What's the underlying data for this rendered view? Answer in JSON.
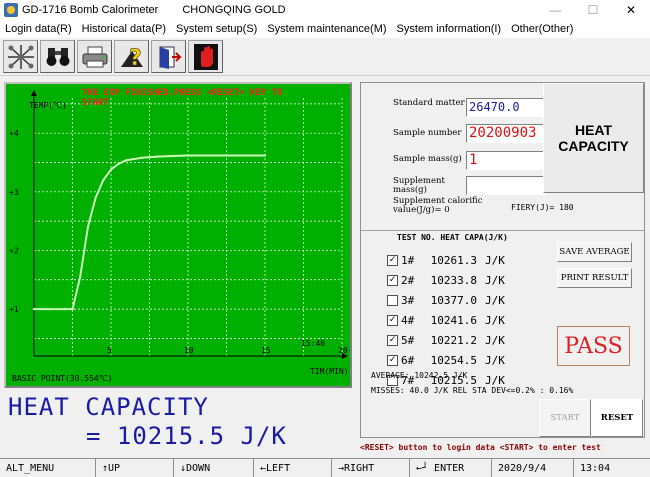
{
  "window": {
    "title": "GD-1716 Bomb Calorimeter",
    "company": "CHONGQING GOLD",
    "minimize": "—",
    "maximize": "☐",
    "close": "✕"
  },
  "menu": [
    "Login data(R)",
    "Historical data(P)",
    "System setup(S)",
    "System maintenance(M)",
    "System information(I)",
    "Other(Other)"
  ],
  "toolbar": {
    "icons": [
      "network-icon",
      "binoculars-icon",
      "printer-icon",
      "help-icon",
      "exit-door-icon",
      "stop-hand-icon"
    ]
  },
  "chart_data": {
    "type": "line",
    "banner": "THE EXP FINISHED,PRESS <RESET> KEY TO START",
    "ylabel": "TEMP(℃)",
    "xlabel": "TIM(MIN)",
    "x_ticks": [
      "5",
      "10",
      "15",
      "20"
    ],
    "y_ticks": [
      "+1",
      "+2",
      "+3",
      "+4"
    ],
    "xlim": [
      0,
      20
    ],
    "ylim": [
      0.2,
      4.6
    ],
    "time_readout": "15:40",
    "basic_point": "BASIC POINT(30.554℃)",
    "grid": true,
    "series": [
      {
        "x": [
          0,
          1,
          2,
          2.5,
          3,
          3.5,
          4,
          4.5,
          5,
          5.5,
          6,
          7,
          8,
          9,
          10,
          11,
          12,
          13,
          14,
          15
        ],
        "y": [
          1.0,
          1.0,
          1.0,
          1.0,
          1.55,
          2.4,
          2.9,
          3.2,
          3.38,
          3.48,
          3.54,
          3.58,
          3.6,
          3.61,
          3.62,
          3.62,
          3.62,
          3.62,
          3.62,
          3.62
        ]
      }
    ],
    "colors": {
      "background": "#00b000",
      "grid": "#ffffff",
      "line": "#c8ffb8",
      "banner": "#ff2020"
    }
  },
  "result": {
    "title": "HEAT CAPACITY",
    "value": "= 10215.5 J/K"
  },
  "form": {
    "standard_matter_label": "Standard matter",
    "standard_matter_value": "26470.0",
    "sample_number_label": "Sample number",
    "sample_number_value": "20200903",
    "sample_mass_label": "Sample mass(g)",
    "sample_mass_value": "1",
    "supplement_mass_label": "Supplement mass(g)",
    "supplement_mass_value": "",
    "supplement_calorific_label": "Supplement calorific value(J/g)= 0",
    "fiery": "FIERY(J)= 180",
    "heat_capacity_button": "HEAT CAPACITY"
  },
  "tests": {
    "header": "TEST NO. HEAT CAPA(J/K)",
    "rows": [
      {
        "checked": true,
        "no": "1#",
        "value": "10261.3",
        "unit": "J/K"
      },
      {
        "checked": true,
        "no": "2#",
        "value": "10233.8",
        "unit": "J/K"
      },
      {
        "checked": false,
        "no": "3#",
        "value": "10377.0",
        "unit": "J/K"
      },
      {
        "checked": true,
        "no": "4#",
        "value": "10241.6",
        "unit": "J/K"
      },
      {
        "checked": true,
        "no": "5#",
        "value": "10221.2",
        "unit": "J/K"
      },
      {
        "checked": true,
        "no": "6#",
        "value": "10254.5",
        "unit": "J/K"
      },
      {
        "checked": false,
        "no": "7#",
        "value": "10215.5",
        "unit": "J/K"
      }
    ],
    "save_average": "SAVE AVERAGE",
    "print_result": "PRINT RESULT",
    "pass": "PASS",
    "average": "AVERAGE: 10242.5  J/K",
    "misses": "MISSES:   40.0 J/K  REL STA DEV<=0.2% : 0.16%",
    "start": "START",
    "reset": "RESET"
  },
  "hint": "<RESET> button to login data <START> to enter test",
  "status": [
    "ALT_MENU",
    "↑UP",
    "↓DOWN",
    "←LEFT",
    "→RIGHT",
    "←┘ ENTER",
    "2020/9/4",
    "13:04"
  ]
}
